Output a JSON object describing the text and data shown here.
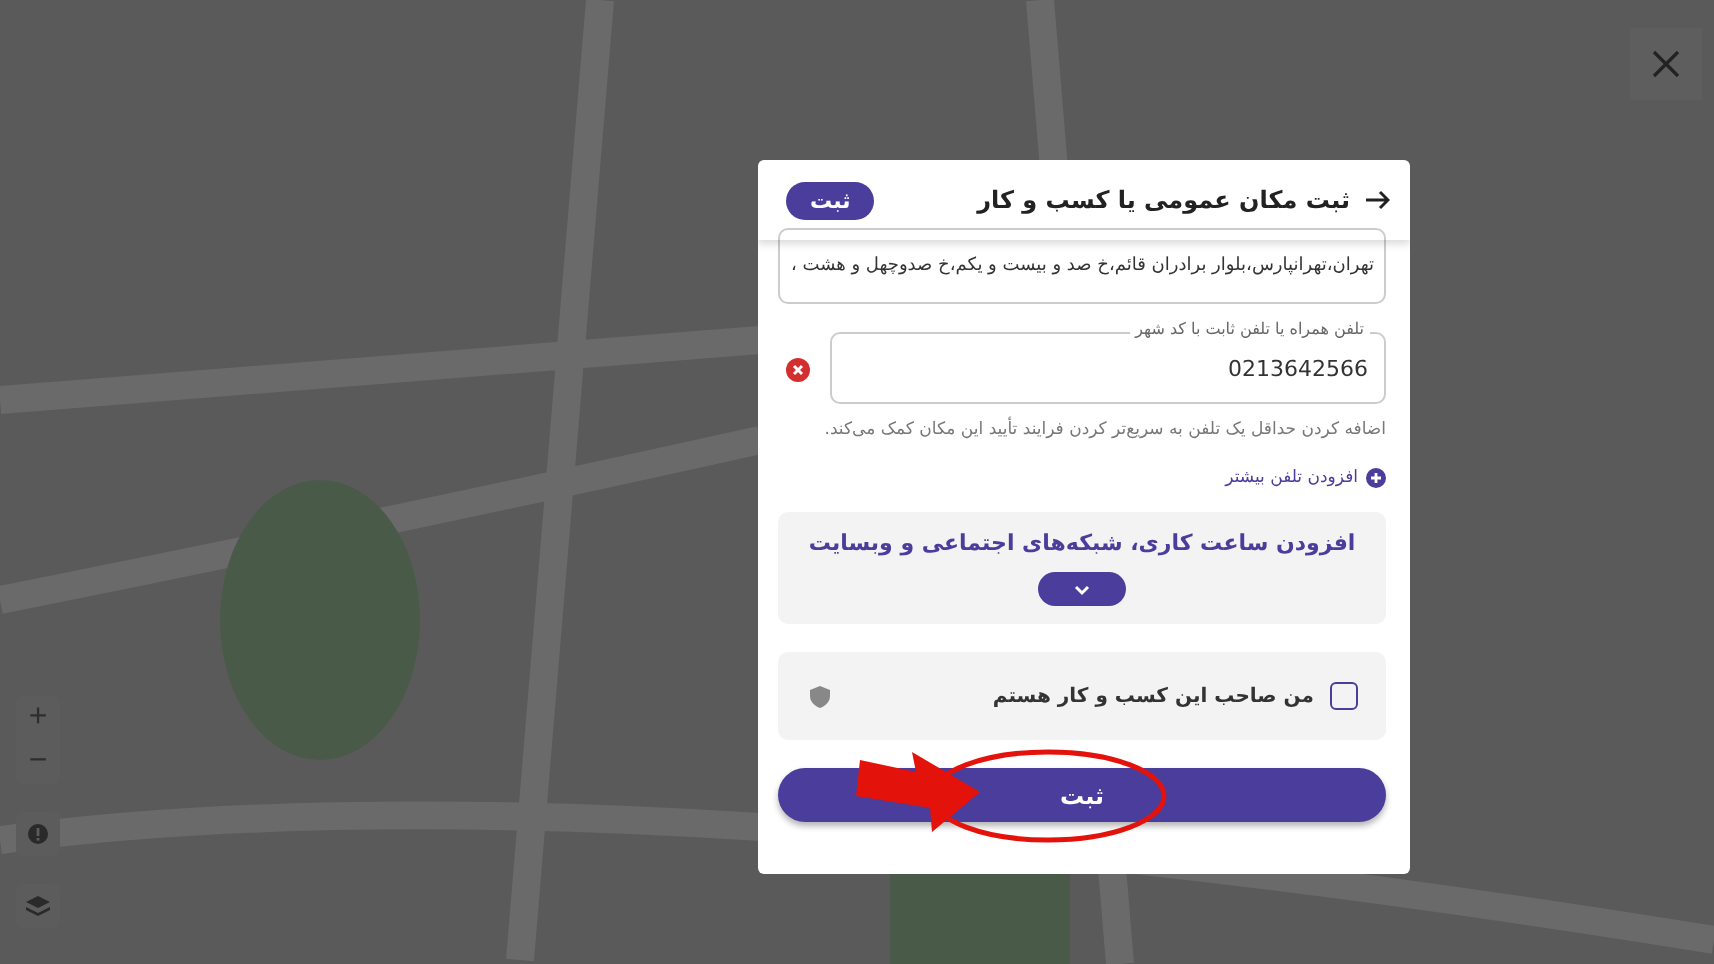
{
  "header": {
    "title": "ثبت مکان عمومی یا کسب و کار",
    "submit_label": "ثبت"
  },
  "address": {
    "value": "تهران،تهرانپارس،بلوار برادران قائم،خ صد و بیست و یکم،خ صدوچهل و هشت ،"
  },
  "phones": [
    {
      "label": "تلفن همراه یا تلفن ثابت با کد شهر",
      "value": "0213642566"
    }
  ],
  "phone_hint": "اضافه کردن حداقل یک تلفن به سریع‌تر کردن فرایند تأیید این مکان کمک می‌کند.",
  "add_phone": "افزودن تلفن بیشتر",
  "more_section": {
    "title": "افزودن ساعت کاری، شبکه‌های اجتماعی و وبسایت",
    "expanded": false
  },
  "owner": {
    "label": "من صاحب این کسب و کار هستم",
    "checked": false
  },
  "submit": "ثبت",
  "map_controls": {
    "zoom_in": "+",
    "zoom_out": "−"
  }
}
